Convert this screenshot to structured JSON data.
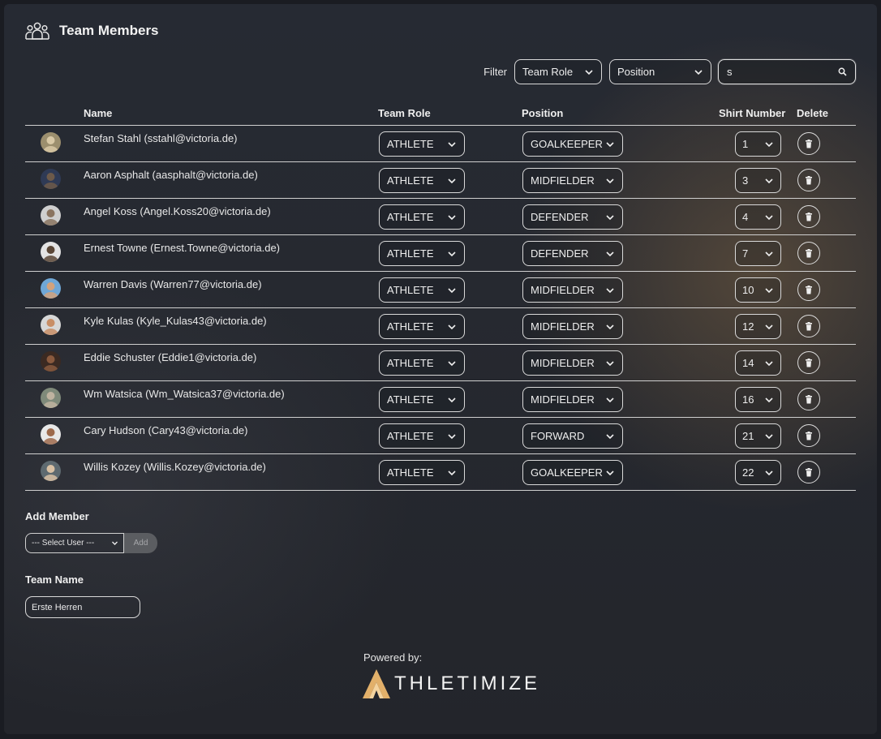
{
  "header": {
    "title": "Team Members",
    "icon": "team-icon"
  },
  "filters": {
    "label": "Filter",
    "team_role": "Team Role",
    "position": "Position",
    "search_value": "s"
  },
  "table": {
    "columns": {
      "name": "Name",
      "team_role": "Team Role",
      "position": "Position",
      "shirt_number": "Shirt Number",
      "delete": "Delete"
    },
    "rows": [
      {
        "name": "Stefan Stahl (sstahl@victoria.de)",
        "role": "ATHLETE",
        "position": "GOALKEEPER",
        "number": "1"
      },
      {
        "name": "Aaron Asphalt (aasphalt@victoria.de)",
        "role": "ATHLETE",
        "position": "MIDFIELDER",
        "number": "3"
      },
      {
        "name": "Angel Koss (Angel.Koss20@victoria.de)",
        "role": "ATHLETE",
        "position": "DEFENDER",
        "number": "4"
      },
      {
        "name": "Ernest Towne (Ernest.Towne@victoria.de)",
        "role": "ATHLETE",
        "position": "DEFENDER",
        "number": "7"
      },
      {
        "name": "Warren Davis (Warren77@victoria.de)",
        "role": "ATHLETE",
        "position": "MIDFIELDER",
        "number": "10"
      },
      {
        "name": "Kyle Kulas (Kyle_Kulas43@victoria.de)",
        "role": "ATHLETE",
        "position": "MIDFIELDER",
        "number": "12"
      },
      {
        "name": "Eddie Schuster (Eddie1@victoria.de)",
        "role": "ATHLETE",
        "position": "MIDFIELDER",
        "number": "14"
      },
      {
        "name": "Wm Watsica (Wm_Watsica37@victoria.de)",
        "role": "ATHLETE",
        "position": "MIDFIELDER",
        "number": "16"
      },
      {
        "name": "Cary Hudson (Cary43@victoria.de)",
        "role": "ATHLETE",
        "position": "FORWARD",
        "number": "21"
      },
      {
        "name": "Willis Kozey (Willis.Kozey@victoria.de)",
        "role": "ATHLETE",
        "position": "GOALKEEPER",
        "number": "22"
      }
    ]
  },
  "add_member": {
    "label": "Add Member",
    "select_placeholder": "--- Select User ---",
    "button": "Add"
  },
  "team_name": {
    "label": "Team Name",
    "value": "Erste Herren"
  },
  "footer": {
    "powered": "Powered by:",
    "brand": "THLETIMIZE",
    "brand_color": "#e8b46a"
  }
}
